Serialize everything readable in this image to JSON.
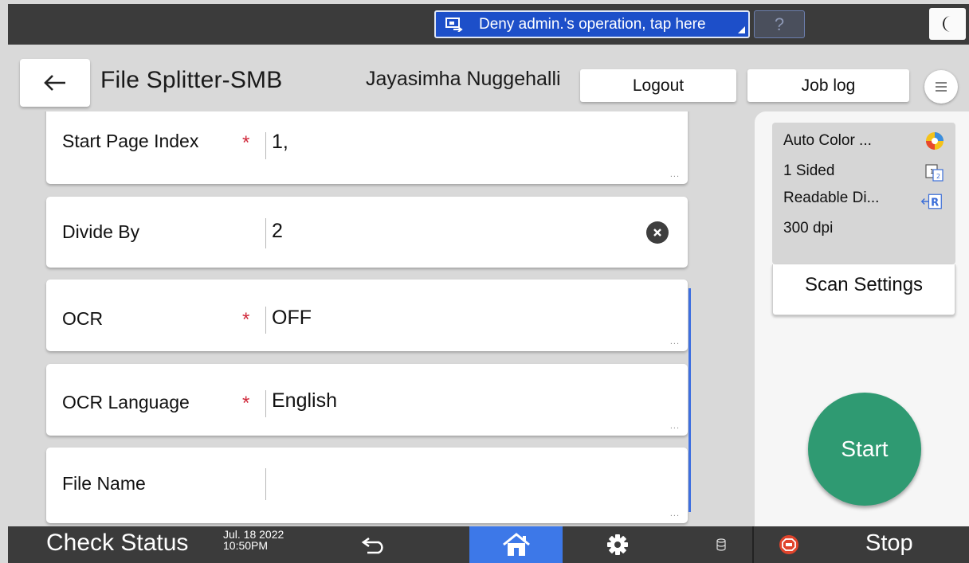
{
  "topbar": {
    "deny_label": "Deny admin.'s operation, tap here",
    "help_label": "?"
  },
  "header": {
    "app_title": "File Splitter-SMB",
    "user_name": "Jayasimha Nuggehalli",
    "logout_label": "Logout",
    "joblog_label": "Job log"
  },
  "form": {
    "rows": [
      {
        "label": "Start Page Index",
        "required": true,
        "value": "1,"
      },
      {
        "label": "Divide By",
        "required": false,
        "value": "2"
      },
      {
        "label": "OCR",
        "required": true,
        "value": "OFF"
      },
      {
        "label": "OCR Language",
        "required": true,
        "value": "English"
      },
      {
        "label": "File Name",
        "required": false,
        "value": ""
      }
    ],
    "required_mark": "*",
    "more_mark": "..."
  },
  "scan_settings": {
    "color": "Auto Color ...",
    "sides": "1 Sided",
    "orientation": "Readable Di...",
    "resolution": "300 dpi",
    "button_label": "Scan Settings"
  },
  "start_label": "Start",
  "bottombar": {
    "check_status": "Check Status",
    "date": "Jul. 18 2022",
    "time": "10:50PM",
    "stop_label": "Stop"
  },
  "colors": {
    "deny_blue": "#1d4fc9",
    "start_green": "#2f9a72",
    "home_active": "#3d78e8",
    "required_red": "#d0283a",
    "stop_red": "#e0442c"
  }
}
